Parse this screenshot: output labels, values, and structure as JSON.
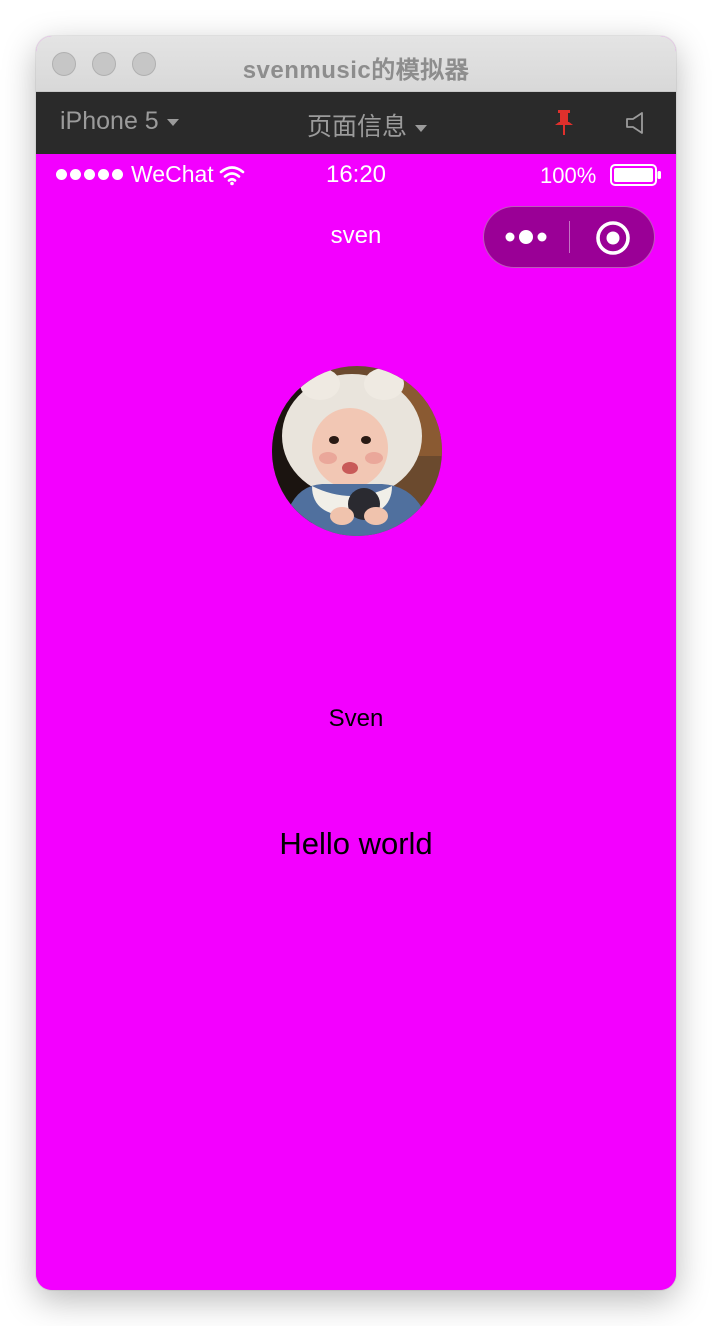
{
  "window": {
    "title": "svenmusic的模拟器"
  },
  "toolbar": {
    "device_label": "iPhone 5",
    "page_info_label": "页面信息",
    "pin_icon": "pin-icon",
    "speaker_icon": "speaker-icon"
  },
  "statusbar": {
    "carrier": "WeChat",
    "time": "16:20",
    "battery_percent": "100%",
    "battery_level": 1.0
  },
  "navbar": {
    "title": "sven",
    "more_icon": "more-dots-icon",
    "exit_icon": "exit-target-icon"
  },
  "page": {
    "avatar_icon": "avatar-photo",
    "nickname": "Sven",
    "motto": "Hello world",
    "background_color": "#f300ff"
  }
}
